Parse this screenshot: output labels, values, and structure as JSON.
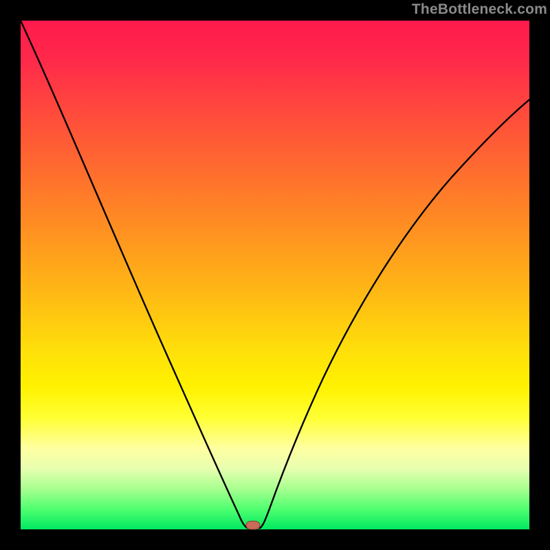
{
  "watermark": {
    "text": "TheBottleneck.com"
  },
  "chart_data": {
    "type": "line",
    "title": "",
    "xlabel": "",
    "ylabel": "",
    "xlim": [
      0,
      100
    ],
    "ylim": [
      0,
      100
    ],
    "grid": false,
    "legend": false,
    "annotations": [],
    "marker": {
      "x": 45,
      "y": 0,
      "color": "#c96b58"
    },
    "series": [
      {
        "name": "curve",
        "color": "#000000",
        "x": [
          0,
          5,
          10,
          15,
          20,
          25,
          30,
          35,
          40,
          42,
          44,
          46,
          48,
          50,
          55,
          60,
          65,
          70,
          75,
          80,
          85,
          90,
          95,
          100
        ],
        "y": [
          100,
          89,
          78,
          67,
          56,
          45,
          33,
          22,
          9,
          3,
          0,
          0,
          4,
          10,
          21,
          31,
          39,
          47,
          53,
          59,
          64,
          68,
          72,
          75
        ]
      }
    ],
    "gradient_stops": [
      {
        "pos": 0.0,
        "color": "#ff1a4d"
      },
      {
        "pos": 0.3,
        "color": "#ff6e2e"
      },
      {
        "pos": 0.65,
        "color": "#ffe00a"
      },
      {
        "pos": 0.85,
        "color": "#ffffa0"
      },
      {
        "pos": 1.0,
        "color": "#00e860"
      }
    ]
  }
}
